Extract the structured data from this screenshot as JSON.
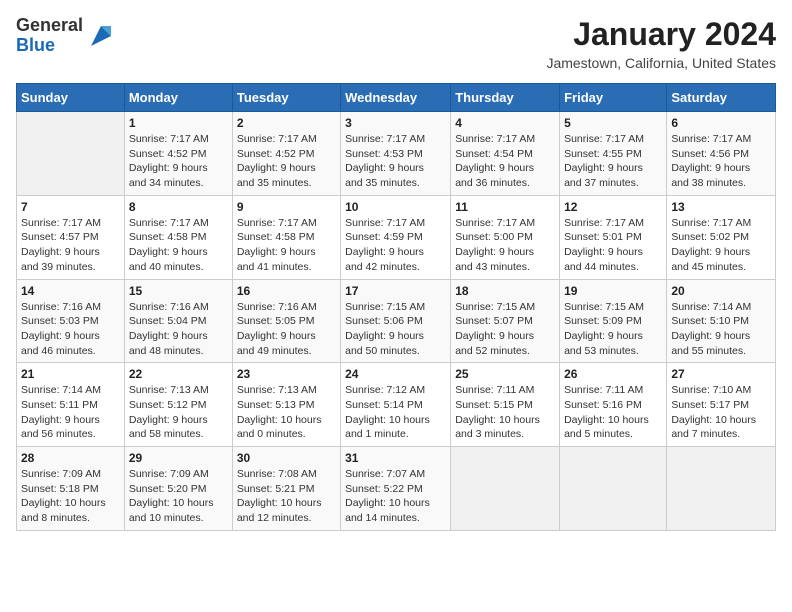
{
  "logo": {
    "general": "General",
    "blue": "Blue"
  },
  "title": "January 2024",
  "subtitle": "Jamestown, California, United States",
  "days": [
    "Sunday",
    "Monday",
    "Tuesday",
    "Wednesday",
    "Thursday",
    "Friday",
    "Saturday"
  ],
  "weeks": [
    [
      {
        "date": "",
        "info": ""
      },
      {
        "date": "1",
        "info": "Sunrise: 7:17 AM\nSunset: 4:52 PM\nDaylight: 9 hours\nand 34 minutes."
      },
      {
        "date": "2",
        "info": "Sunrise: 7:17 AM\nSunset: 4:52 PM\nDaylight: 9 hours\nand 35 minutes."
      },
      {
        "date": "3",
        "info": "Sunrise: 7:17 AM\nSunset: 4:53 PM\nDaylight: 9 hours\nand 35 minutes."
      },
      {
        "date": "4",
        "info": "Sunrise: 7:17 AM\nSunset: 4:54 PM\nDaylight: 9 hours\nand 36 minutes."
      },
      {
        "date": "5",
        "info": "Sunrise: 7:17 AM\nSunset: 4:55 PM\nDaylight: 9 hours\nand 37 minutes."
      },
      {
        "date": "6",
        "info": "Sunrise: 7:17 AM\nSunset: 4:56 PM\nDaylight: 9 hours\nand 38 minutes."
      }
    ],
    [
      {
        "date": "7",
        "info": "Sunrise: 7:17 AM\nSunset: 4:57 PM\nDaylight: 9 hours\nand 39 minutes."
      },
      {
        "date": "8",
        "info": "Sunrise: 7:17 AM\nSunset: 4:58 PM\nDaylight: 9 hours\nand 40 minutes."
      },
      {
        "date": "9",
        "info": "Sunrise: 7:17 AM\nSunset: 4:58 PM\nDaylight: 9 hours\nand 41 minutes."
      },
      {
        "date": "10",
        "info": "Sunrise: 7:17 AM\nSunset: 4:59 PM\nDaylight: 9 hours\nand 42 minutes."
      },
      {
        "date": "11",
        "info": "Sunrise: 7:17 AM\nSunset: 5:00 PM\nDaylight: 9 hours\nand 43 minutes."
      },
      {
        "date": "12",
        "info": "Sunrise: 7:17 AM\nSunset: 5:01 PM\nDaylight: 9 hours\nand 44 minutes."
      },
      {
        "date": "13",
        "info": "Sunrise: 7:17 AM\nSunset: 5:02 PM\nDaylight: 9 hours\nand 45 minutes."
      }
    ],
    [
      {
        "date": "14",
        "info": "Sunrise: 7:16 AM\nSunset: 5:03 PM\nDaylight: 9 hours\nand 46 minutes."
      },
      {
        "date": "15",
        "info": "Sunrise: 7:16 AM\nSunset: 5:04 PM\nDaylight: 9 hours\nand 48 minutes."
      },
      {
        "date": "16",
        "info": "Sunrise: 7:16 AM\nSunset: 5:05 PM\nDaylight: 9 hours\nand 49 minutes."
      },
      {
        "date": "17",
        "info": "Sunrise: 7:15 AM\nSunset: 5:06 PM\nDaylight: 9 hours\nand 50 minutes."
      },
      {
        "date": "18",
        "info": "Sunrise: 7:15 AM\nSunset: 5:07 PM\nDaylight: 9 hours\nand 52 minutes."
      },
      {
        "date": "19",
        "info": "Sunrise: 7:15 AM\nSunset: 5:09 PM\nDaylight: 9 hours\nand 53 minutes."
      },
      {
        "date": "20",
        "info": "Sunrise: 7:14 AM\nSunset: 5:10 PM\nDaylight: 9 hours\nand 55 minutes."
      }
    ],
    [
      {
        "date": "21",
        "info": "Sunrise: 7:14 AM\nSunset: 5:11 PM\nDaylight: 9 hours\nand 56 minutes."
      },
      {
        "date": "22",
        "info": "Sunrise: 7:13 AM\nSunset: 5:12 PM\nDaylight: 9 hours\nand 58 minutes."
      },
      {
        "date": "23",
        "info": "Sunrise: 7:13 AM\nSunset: 5:13 PM\nDaylight: 10 hours\nand 0 minutes."
      },
      {
        "date": "24",
        "info": "Sunrise: 7:12 AM\nSunset: 5:14 PM\nDaylight: 10 hours\nand 1 minute."
      },
      {
        "date": "25",
        "info": "Sunrise: 7:11 AM\nSunset: 5:15 PM\nDaylight: 10 hours\nand 3 minutes."
      },
      {
        "date": "26",
        "info": "Sunrise: 7:11 AM\nSunset: 5:16 PM\nDaylight: 10 hours\nand 5 minutes."
      },
      {
        "date": "27",
        "info": "Sunrise: 7:10 AM\nSunset: 5:17 PM\nDaylight: 10 hours\nand 7 minutes."
      }
    ],
    [
      {
        "date": "28",
        "info": "Sunrise: 7:09 AM\nSunset: 5:18 PM\nDaylight: 10 hours\nand 8 minutes."
      },
      {
        "date": "29",
        "info": "Sunrise: 7:09 AM\nSunset: 5:20 PM\nDaylight: 10 hours\nand 10 minutes."
      },
      {
        "date": "30",
        "info": "Sunrise: 7:08 AM\nSunset: 5:21 PM\nDaylight: 10 hours\nand 12 minutes."
      },
      {
        "date": "31",
        "info": "Sunrise: 7:07 AM\nSunset: 5:22 PM\nDaylight: 10 hours\nand 14 minutes."
      },
      {
        "date": "",
        "info": ""
      },
      {
        "date": "",
        "info": ""
      },
      {
        "date": "",
        "info": ""
      }
    ]
  ]
}
